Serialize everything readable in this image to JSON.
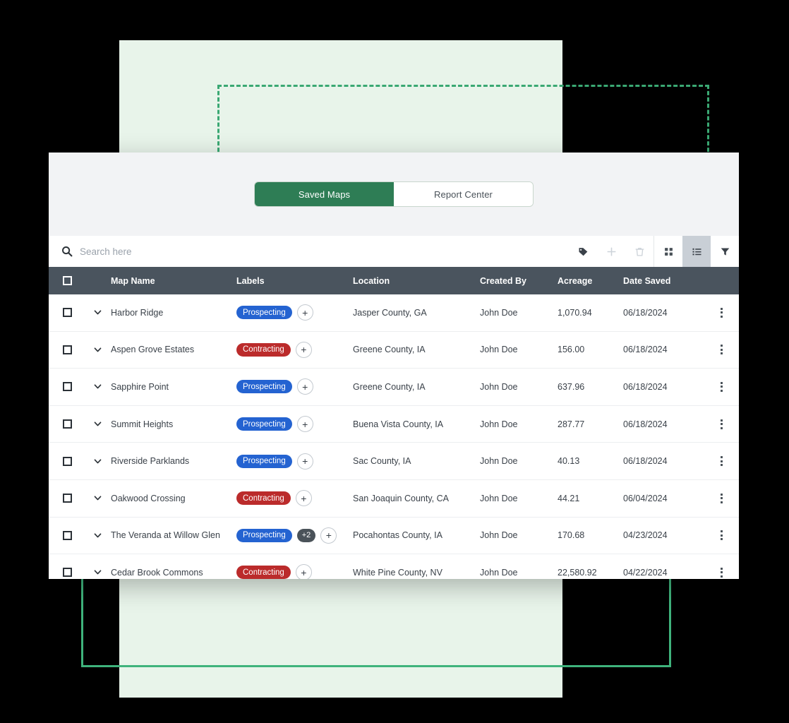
{
  "colors": {
    "accent_green": "#2e7d55",
    "panel_green": "#e8f4ea",
    "outline_green": "#3fb37c",
    "header_slate": "#4a545e",
    "label_blue": "#2463d1",
    "label_red": "#bb2b2b",
    "more_badge": "#4a5259"
  },
  "tabs": [
    {
      "label": "Saved Maps",
      "active": true
    },
    {
      "label": "Report Center",
      "active": false
    }
  ],
  "search": {
    "placeholder": "Search here",
    "value": "",
    "icon": "search-icon"
  },
  "toolbar_actions": [
    {
      "name": "tag-icon",
      "enabled": true
    },
    {
      "name": "plus-icon",
      "enabled": false
    },
    {
      "name": "trash-icon",
      "enabled": false
    },
    {
      "name": "grid-view-icon",
      "enabled": true,
      "selected": false
    },
    {
      "name": "list-view-icon",
      "enabled": true,
      "selected": true
    },
    {
      "name": "filter-icon",
      "enabled": true,
      "selected": false
    }
  ],
  "table": {
    "columns": [
      "Map Name",
      "Labels",
      "Location",
      "Created By",
      "Acreage",
      "Date Saved"
    ],
    "rows": [
      {
        "name": "Harbor Ridge",
        "labels": [
          {
            "text": "Prospecting",
            "color": "blue"
          }
        ],
        "more": null,
        "location": "Jasper County, GA",
        "created_by": "John Doe",
        "acreage": "1,070.94",
        "date_saved": "06/18/2024"
      },
      {
        "name": "Aspen Grove Estates",
        "labels": [
          {
            "text": "Contracting",
            "color": "red"
          }
        ],
        "more": null,
        "location": "Greene County, IA",
        "created_by": "John Doe",
        "acreage": "156.00",
        "date_saved": "06/18/2024"
      },
      {
        "name": "Sapphire Point",
        "labels": [
          {
            "text": "Prospecting",
            "color": "blue"
          }
        ],
        "more": null,
        "location": "Greene County, IA",
        "created_by": "John Doe",
        "acreage": "637.96",
        "date_saved": "06/18/2024"
      },
      {
        "name": "Summit Heights",
        "labels": [
          {
            "text": "Prospecting",
            "color": "blue"
          }
        ],
        "more": null,
        "location": "Buena Vista County, IA",
        "created_by": "John Doe",
        "acreage": "287.77",
        "date_saved": "06/18/2024"
      },
      {
        "name": "Riverside Parklands",
        "labels": [
          {
            "text": "Prospecting",
            "color": "blue"
          }
        ],
        "more": null,
        "location": "Sac County, IA",
        "created_by": "John Doe",
        "acreage": "40.13",
        "date_saved": "06/18/2024"
      },
      {
        "name": "Oakwood Crossing",
        "labels": [
          {
            "text": "Contracting",
            "color": "red"
          }
        ],
        "more": null,
        "location": "San Joaquin County, CA",
        "created_by": "John Doe",
        "acreage": "44.21",
        "date_saved": "06/04/2024"
      },
      {
        "name": "The Veranda at Willow Glen",
        "labels": [
          {
            "text": "Prospecting",
            "color": "blue"
          }
        ],
        "more": "+2",
        "location": "Pocahontas County, IA",
        "created_by": "John Doe",
        "acreage": "170.68",
        "date_saved": "04/23/2024"
      },
      {
        "name": "Cedar Brook Commons",
        "labels": [
          {
            "text": "Contracting",
            "color": "red"
          }
        ],
        "more": null,
        "location": "White Pine County, NV",
        "created_by": "John Doe",
        "acreage": "22,580.92",
        "date_saved": "04/22/2024"
      }
    ],
    "add_label_glyph": "+"
  }
}
